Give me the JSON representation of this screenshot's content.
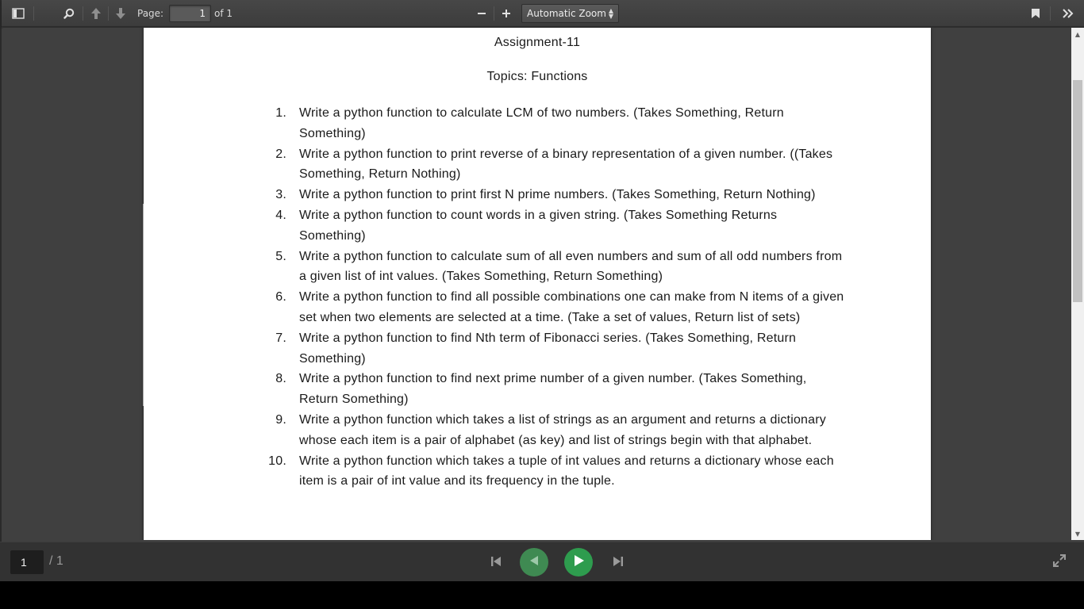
{
  "toolbar": {
    "page_label": "Page:",
    "page_value": "1",
    "page_of": "of 1",
    "zoom_value": "Automatic Zoom",
    "zoom_caret": "▲▼"
  },
  "icons": {
    "sidebar_toggle": "sidebar-toggle-icon",
    "search": "search-icon",
    "prev_page": "arrow-up-icon",
    "next_page": "arrow-down-icon",
    "zoom_out": "minus-icon",
    "zoom_in": "plus-icon",
    "bookmark": "bookmark-icon",
    "tools": "double-chevron-right-icon",
    "first": "skip-first-icon",
    "previous": "play-back-icon",
    "play": "play-icon",
    "last": "skip-last-icon",
    "fullscreen": "fullscreen-icon"
  },
  "document": {
    "title": "Assignment-11",
    "subtitle": "Topics: Functions",
    "items": [
      {
        "num": "1.",
        "text": "Write a python function to calculate LCM of two numbers. (Takes Something, Return Something)"
      },
      {
        "num": "2.",
        "text": "Write a python function to print reverse of a binary representation of a given number. ((Takes Something, Return Nothing)"
      },
      {
        "num": "3.",
        "text": "Write a python function to print first N prime numbers. (Takes Something, Return Nothing)"
      },
      {
        "num": "4.",
        "text": "Write a python function to count words in a given string. (Takes Something Returns Something)"
      },
      {
        "num": "5.",
        "text": "Write a python function to calculate sum of all even numbers and sum of all odd numbers from a given list of int values. (Takes Something, Return Something)"
      },
      {
        "num": "6.",
        "text": "Write a python function to find all possible combinations one can make from N items of a given set when two elements are selected at a time. (Take a set of values, Return list of sets)"
      },
      {
        "num": "7.",
        "text": "Write a python function to find Nth term of Fibonacci series. (Takes Something, Return Something)"
      },
      {
        "num": "8.",
        "text": "Write a python function to find next prime number of a given number. (Takes Something, Return Something)"
      },
      {
        "num": "9.",
        "text": "Write a python function which takes a list of strings as an argument and returns a dictionary whose each item is a pair of alphabet (as key) and list of strings begin with that alphabet."
      },
      {
        "num": "10.",
        "text": "Write a python function which takes a tuple of int values and returns a dictionary whose each item is a pair of int value and its frequency in the tuple."
      }
    ]
  },
  "bottom_bar": {
    "page_value": "1",
    "page_total": "/ 1"
  },
  "colors": {
    "toolbar_bg": "#424242",
    "viewer_bg": "#404040",
    "bottom_bar_bg": "#323232",
    "green_button": "#2e9c4e",
    "green_button_dim": "#3f8a52"
  }
}
